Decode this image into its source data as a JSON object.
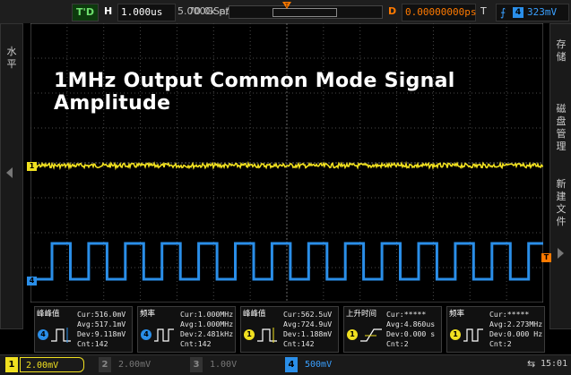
{
  "top_bar": {
    "trigger_mode": "T'D",
    "horizontal_label": "H",
    "timebase": "1.000us",
    "sample_rate": "5.000GSa/s",
    "memory_depth": "70.0k pts",
    "delay_label": "D",
    "delay_value": "0.00000000ps",
    "trigger_label": "T",
    "trigger_edge_icon": "rising-edge-icon",
    "trigger_source": "4",
    "trigger_level": "323mV"
  },
  "left_panel": {
    "chars": [
      "水",
      "平"
    ]
  },
  "right_panel": {
    "chars_top": [
      "存",
      "储"
    ],
    "chars_mid": [
      "磁",
      "盘",
      "管",
      "理"
    ],
    "chars_bot": [
      "新",
      "建",
      "文",
      "件"
    ]
  },
  "markers": {
    "ch1": "1",
    "ch4": "4",
    "trigger": "T"
  },
  "overlay_title": "1MHz Output Common Mode Signal Amplitude",
  "measurements": [
    {
      "name": "峰峰值",
      "channel": "4",
      "icon": "peak-peak-icon",
      "lines": [
        "Cur:516.0mV",
        "Avg:517.1mV",
        "Dev:9.118mV",
        "Cnt:142"
      ]
    },
    {
      "name": "频率",
      "channel": "4",
      "icon": "frequency-icon",
      "lines": [
        "Cur:1.000MHz",
        "Avg:1.000MHz",
        "Dev:2.481kHz",
        "Cnt:142"
      ]
    },
    {
      "name": "峰峰值",
      "channel": "1",
      "icon": "peak-peak-icon",
      "lines": [
        "Cur:562.5uV",
        "Avg:724.9uV",
        "Dev:1.188mV",
        "Cnt:142"
      ]
    },
    {
      "name": "上升时间",
      "channel": "1",
      "icon": "rise-time-icon",
      "lines": [
        "Cur:*****",
        "Avg:4.860us",
        "Dev:0.000 s",
        "Cnt:2"
      ]
    },
    {
      "name": "频率",
      "channel": "1",
      "icon": "frequency-icon",
      "lines": [
        "Cur:*****",
        "Avg:2.273MHz",
        "Dev:0.000 Hz",
        "Cnt:2"
      ]
    }
  ],
  "bottom_bar": {
    "channels": [
      {
        "num": "1",
        "scale": "2.00mV",
        "color": "#f0e020"
      },
      {
        "num": "2",
        "scale": "2.00mV",
        "color": "#777777"
      },
      {
        "num": "3",
        "scale": "1.00V",
        "color": "#777777"
      },
      {
        "num": "4",
        "scale": "500mV",
        "color": "#2a8ee8"
      }
    ],
    "time": "15:01"
  },
  "colors": {
    "ch1": "#f0e020",
    "ch4": "#2a8ee8",
    "trigger": "#ff7a00",
    "grid": "#4a4a4a"
  }
}
